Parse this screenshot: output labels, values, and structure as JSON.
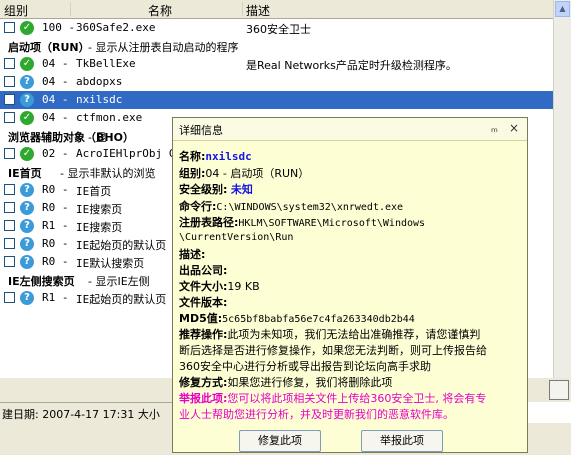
{
  "header": {
    "group": "组别",
    "name": "名称",
    "desc": "描述"
  },
  "rows": [
    {
      "type": "item",
      "checkbox": true,
      "icon": "ok",
      "group": "100 -",
      "name": "360Safe2.exe",
      "desc": "360安全卫士"
    },
    {
      "type": "group",
      "name": "启动项（RUN）",
      "desc": "- 显示从注册表自动启动的程序"
    },
    {
      "type": "item",
      "checkbox": true,
      "icon": "ok",
      "group": "04 -",
      "name": "TkBellExe",
      "desc": "是Real Networks产品定时升级检测程序。"
    },
    {
      "type": "item",
      "checkbox": true,
      "icon": "q",
      "group": "04 -",
      "name": "abdopxs",
      "desc": ""
    },
    {
      "type": "item",
      "checkbox": true,
      "icon": "q",
      "group": "04 -",
      "name": "nxilsdc",
      "desc": "",
      "selected": true
    },
    {
      "type": "item",
      "checkbox": true,
      "icon": "ok",
      "group": "04 -",
      "name": "ctfmon.exe",
      "desc": ""
    },
    {
      "type": "group",
      "name": "浏览器辅助对象（BHO）",
      "desc": "- 显"
    },
    {
      "type": "item",
      "checkbox": true,
      "icon": "ok",
      "group": "02 -",
      "name": "AcroIEHlprObj Cl",
      "desc": ""
    },
    {
      "type": "group",
      "name": "IE首页",
      "desc": "- 显示非默认的浏览"
    },
    {
      "type": "item",
      "checkbox": true,
      "icon": "q",
      "group": "R0 -",
      "name": "IE首页",
      "desc": ""
    },
    {
      "type": "item",
      "checkbox": true,
      "icon": "q",
      "group": "R0 -",
      "name": "IE搜索页",
      "desc": ""
    },
    {
      "type": "item",
      "checkbox": true,
      "icon": "q",
      "group": "R1 -",
      "name": "IE搜索页",
      "desc": ""
    },
    {
      "type": "item",
      "checkbox": true,
      "icon": "q",
      "group": "R0 -",
      "name": "IE起始页的默认页",
      "desc": ""
    },
    {
      "type": "item",
      "checkbox": true,
      "icon": "q",
      "group": "R0 -",
      "name": "IE默认搜索页",
      "desc": ""
    },
    {
      "type": "group",
      "name": "IE左侧搜索页",
      "desc": "- 显示IE左侧"
    },
    {
      "type": "item",
      "checkbox": true,
      "icon": "q",
      "group": "R1 -",
      "name": "IE起始页的默认页",
      "desc": ""
    }
  ],
  "status": {
    "text": "建日期:  2007-4-17  17:31  大小"
  },
  "popup": {
    "title": "详细信息",
    "pin": "ₘ",
    "close": "×",
    "name_label": "名称:",
    "name_value": "nxilsdc",
    "group_label": "组别:",
    "group_value": "04 - 启动项（RUN）",
    "level_label": "安全级别:",
    "level_value": "未知",
    "cmd_label": "命令行:",
    "cmd_value": "C:\\WINDOWS\\system32\\xnrwedt.exe",
    "reg_label": "注册表路径:",
    "reg_value_1": "HKLM\\SOFTWARE\\Microsoft\\Windows",
    "reg_value_2": "\\CurrentVersion\\Run",
    "desc_label": "描述:",
    "company_label": "出品公司:",
    "size_label": "文件大小:",
    "size_value": "19 KB",
    "version_label": "文件版本:",
    "md5_label": "MD5值:",
    "md5_value": "5c65bf8babfa56e7c4fa263340db2b44",
    "rec_label": "推荐操作:",
    "rec_value_1": "此项为未知项，我们无法给出准确推荐，请您谨慎判",
    "rec_value_2": "断后选择是否进行修复操作，如果您无法判断，则可上传报告给",
    "rec_value_3": "360安全中心进行分析或导出报告到论坛向高手求助",
    "fix_label": "修复方式:",
    "fix_value": "如果您进行修复，我们将删除此项",
    "report_label": "举报此项:",
    "report_value_1": "您可以将此项相关文件上传给360安全卫士, 将会有专",
    "report_value_2": "业人士帮助您进行分析，并及时更新我们的恶意软件库。",
    "repair_button": "修复此项",
    "report_button": "举报此项"
  }
}
